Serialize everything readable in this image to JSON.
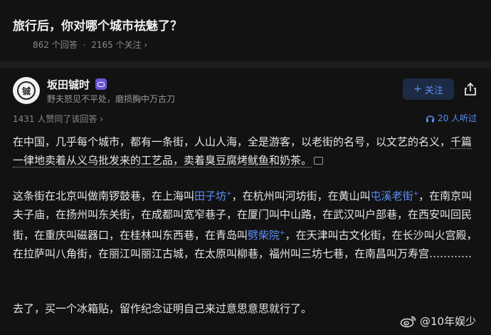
{
  "question": {
    "title": "旅行后，你对哪个城市祛魅了？",
    "answers": "862 个回答",
    "dot": "·",
    "followers": "2165 个关注",
    "chevron": "›"
  },
  "author": {
    "name": "坂田铖时",
    "bio": "野夫怒见不平处，磨损胸中万古刀",
    "avatar_glyph": "铖",
    "follow_label": "关注",
    "follow_plus": "+"
  },
  "answer_meta": {
    "upvotes": "1431 人赞同了该回答",
    "chevron": "›",
    "listen": "20 人听过"
  },
  "content": {
    "p1_a": "在中国，几乎每个城市，都有一条街，人山人海，全是游客，以老街的名号，以文艺的名义，",
    "p1_b": "千篇一律地卖着从义乌批发来的工艺品，卖着臭豆腐烤鱿鱼和奶茶。",
    "p2_a": "这条街在北京叫做南锣鼓巷，在上海叫",
    "p2_link1": "田子坊",
    "p2_b": "，在杭州叫河坊街，在黄山叫",
    "p2_link2": "屯溪老街",
    "p2_c": "，在南京叫夫子庙，在扬州叫东关街，在成都叫宽窄巷子，在厦门叫中山路，在武汉叫户部巷，在西安叫回民街，在重庆叫磁器口，在桂林叫东西巷，在青岛叫",
    "p2_link3": "劈柴院",
    "p2_d": "，在天津叫古文化街，在长沙叫火宫殿，在拉萨叫八角街，在丽江叫丽江古城，在太原叫柳巷，福州叫三坊七巷，在南昌叫万寿宫…………",
    "link_mark": "+",
    "p3": "去了，买一个冰箱贴，留作纪念证明自己来过意思意思就行了。"
  },
  "watermark": {
    "text": "@10年娱少"
  },
  "colors": {
    "background": "#121212",
    "accent": "#5b8ff9",
    "badge": "#6a55d6"
  }
}
